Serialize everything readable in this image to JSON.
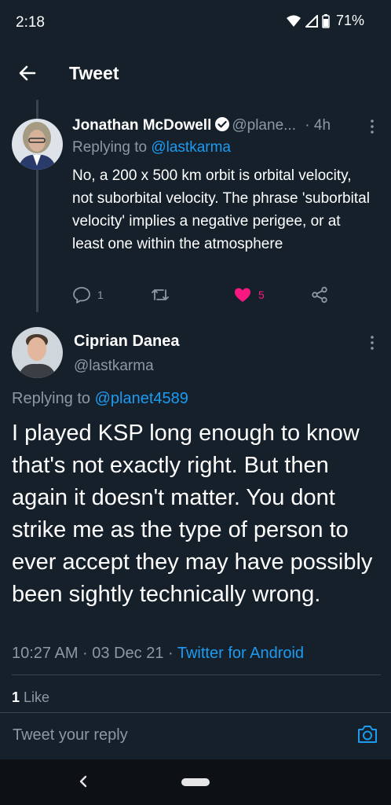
{
  "status_bar": {
    "time": "2:18",
    "battery": "71%"
  },
  "header": {
    "title": "Tweet"
  },
  "reply_tweet": {
    "author_name": "Jonathan McDowell",
    "handle": "@plane...",
    "age": "· 4h",
    "replying_prefix": "Replying to",
    "replying_handle": "@lastkarma",
    "text": "No, a 200 x 500 km orbit is orbital velocity, not suborbital velocity. The phrase 'suborbital velocity' implies a negative perigee, or at least one within the atmosphere",
    "reply_count": "1",
    "retweet_count": "",
    "like_count": "5"
  },
  "main_tweet": {
    "author_name": "Ciprian Danea",
    "handle": "@lastkarma",
    "replying_prefix": "Replying to",
    "replying_handle": "@planet4589",
    "text": "I played KSP long enough to know that's not exactly right. But then again it doesn't matter. You dont strike me as the type of person to ever accept they may have possibly been sightly technically wrong.",
    "timestamp": "10:27 AM · 03 Dec 21 · ",
    "source": "Twitter for Android",
    "likes_count": "1",
    "likes_label": "Like"
  },
  "reply_box": {
    "placeholder": "Tweet your reply"
  },
  "colors": {
    "background": "#15202b",
    "accent": "#1d9bf0",
    "like": "#f91880",
    "muted": "#8b98a5",
    "divider": "#38444d"
  }
}
